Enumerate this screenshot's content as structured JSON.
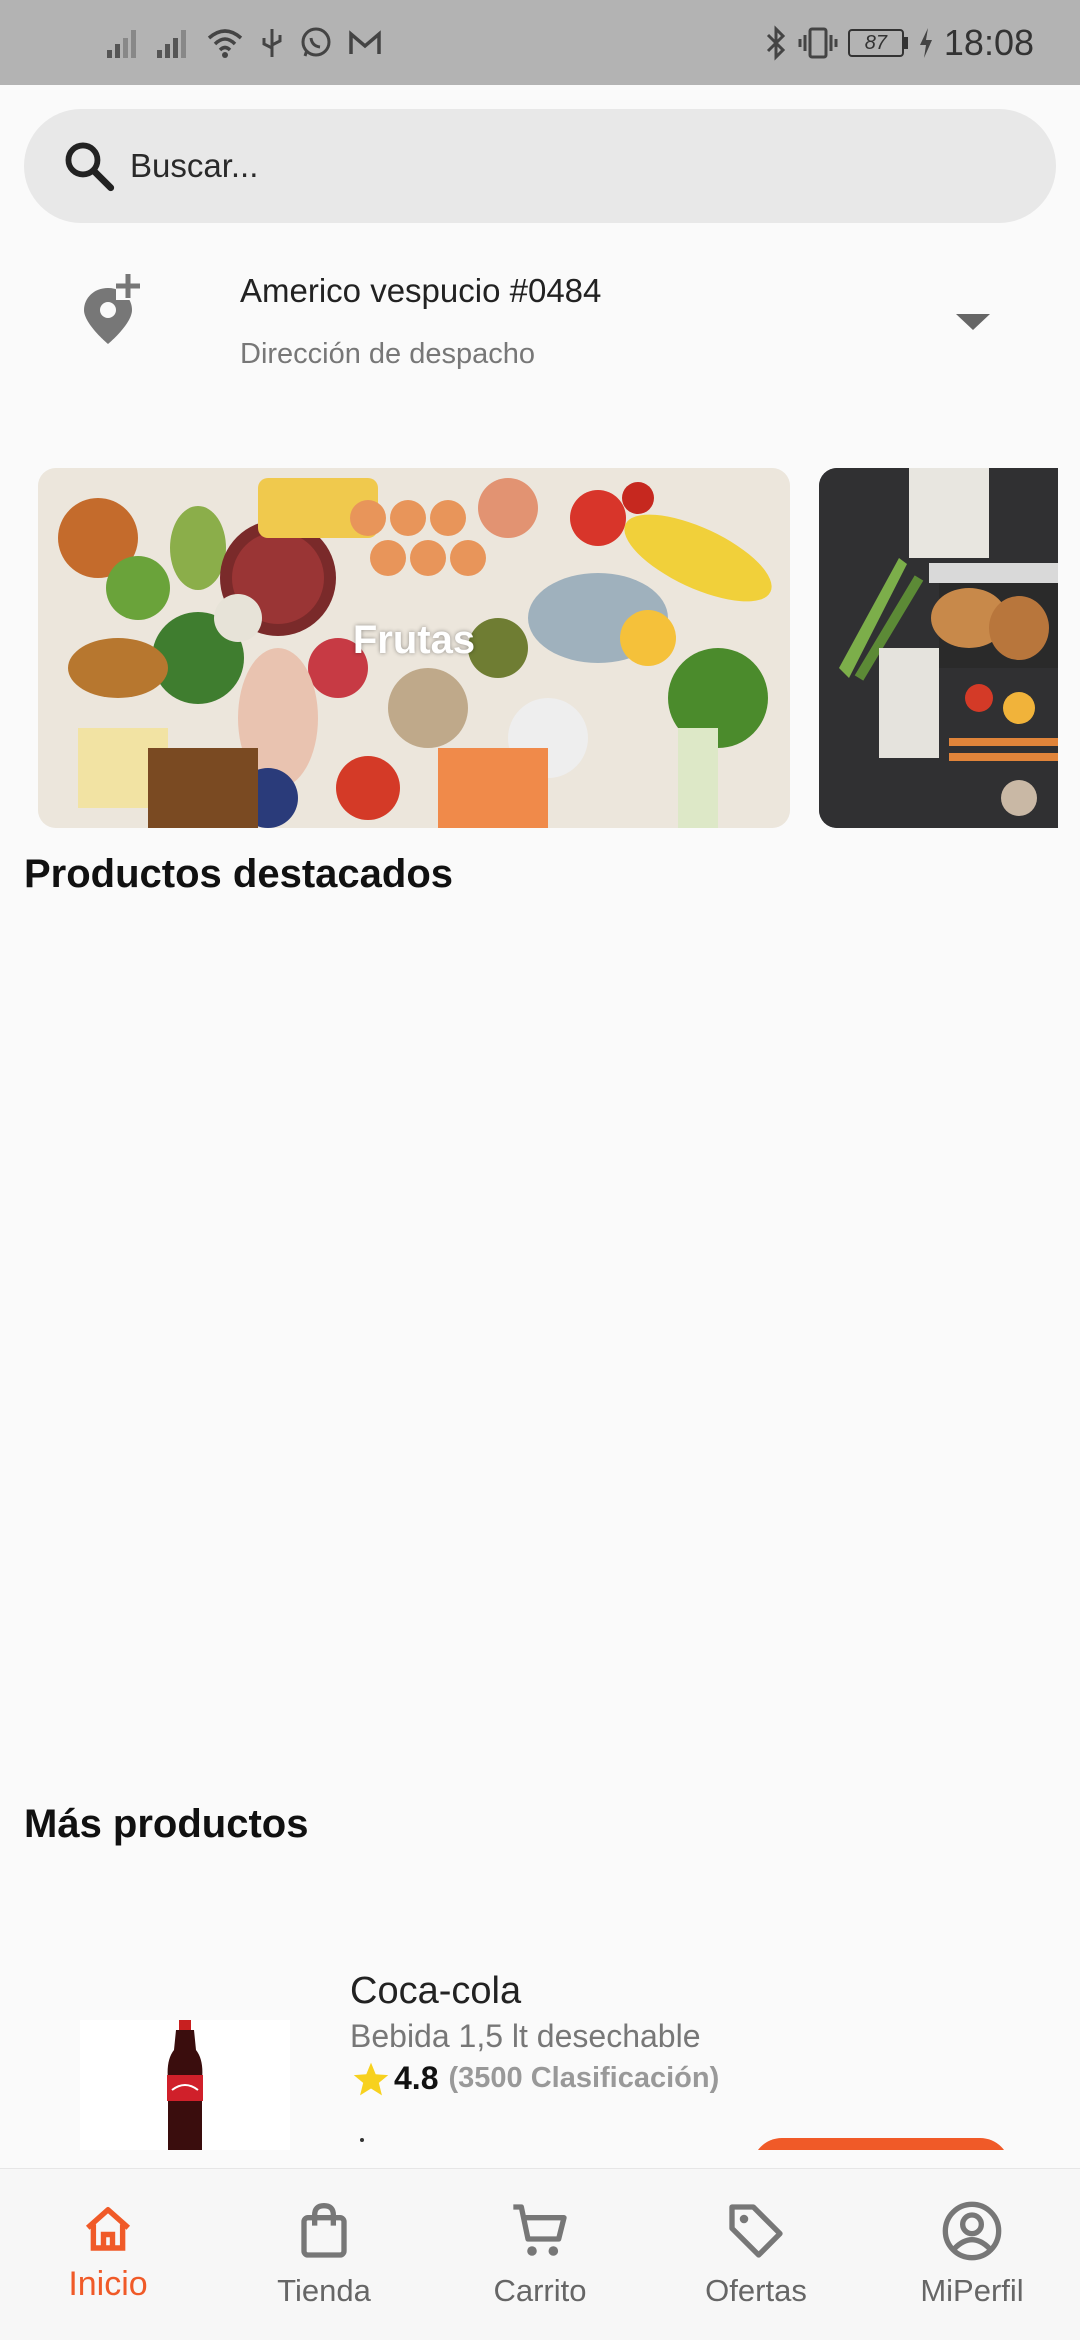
{
  "status_bar": {
    "time": "18:08",
    "battery": "87"
  },
  "search": {
    "placeholder": "Buscar..."
  },
  "address": {
    "title": "Americo vespucio #0484",
    "subtitle": "Dirección de despacho"
  },
  "categories": [
    {
      "label": "Frutas"
    },
    {
      "label": ""
    }
  ],
  "sections": {
    "featured_title": "Productos destacados",
    "more_title": "Más productos"
  },
  "products": [
    {
      "name": "Coca-cola",
      "description": "Bebida 1,5 lt desechable",
      "rating": "4.8",
      "rating_count": "(3500 Clasificación)"
    }
  ],
  "nav": {
    "items": [
      {
        "label": "Inicio",
        "icon": "home-icon"
      },
      {
        "label": "Tienda",
        "icon": "shopping-bag-icon"
      },
      {
        "label": "Carrito",
        "icon": "cart-icon"
      },
      {
        "label": "Ofertas",
        "icon": "tag-icon"
      },
      {
        "label": "MiPerfil",
        "icon": "profile-icon"
      }
    ],
    "active_index": 0
  },
  "colors": {
    "accent": "#f05a28",
    "status_bar": "#b3b3b3",
    "background": "#fafafa",
    "search_bg": "#e8e8e8"
  }
}
